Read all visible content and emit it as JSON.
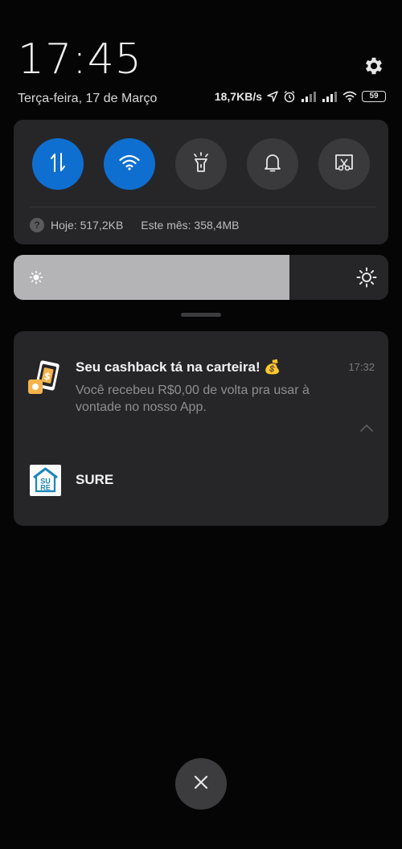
{
  "status": {
    "time": "17:45",
    "date": "Terça-feira, 17 de Março",
    "network_speed": "18,7KB/s",
    "battery": "59"
  },
  "quick_settings": {
    "toggles": [
      {
        "icon": "mobile-data-icon",
        "on": true
      },
      {
        "icon": "wifi-icon",
        "on": true
      },
      {
        "icon": "flashlight-icon",
        "on": false
      },
      {
        "icon": "bell-icon",
        "on": false
      },
      {
        "icon": "screenshot-icon",
        "on": false
      }
    ],
    "usage_today": "Hoje: 517,2KB",
    "usage_month": "Este mês: 358,4MB"
  },
  "brightness": {
    "level": 0.735
  },
  "notifications": {
    "card": {
      "title": "Seu cashback tá na carteira! 💰",
      "time": "17:32",
      "body": "Você recebeu R$0,00 de volta pra usar à vontade no nosso App."
    },
    "group_label": "SURE",
    "group_icon_text_top": "SU",
    "group_icon_text_bottom": "RE"
  },
  "colors": {
    "accent": "#0f6fd0",
    "panel": "#262628",
    "background": "#050505"
  }
}
